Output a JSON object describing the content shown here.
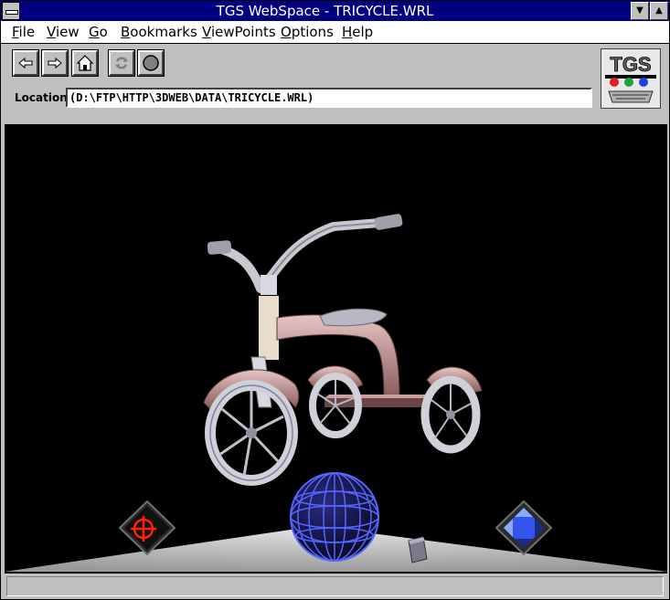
{
  "window": {
    "title": "TGS WebSpace - TRICYCLE.WRL",
    "minimize_glyph": "▼",
    "maximize_glyph": "▲"
  },
  "menubar": {
    "items": [
      {
        "label": "File"
      },
      {
        "label": "View"
      },
      {
        "label": "Go"
      },
      {
        "label": "Bookmarks"
      },
      {
        "label": "ViewPoints"
      },
      {
        "label": "Options"
      },
      {
        "label": "Help"
      }
    ]
  },
  "toolbar": {
    "buttons": [
      {
        "icon": "back-arrow-icon"
      },
      {
        "icon": "forward-arrow-icon"
      },
      {
        "icon": "home-icon"
      },
      {
        "icon": "reload-icon",
        "disabled": true
      },
      {
        "icon": "stop-icon"
      }
    ],
    "logo_text": "TGS"
  },
  "location": {
    "label": "Location:",
    "value": "(D:\\FTP\\HTTP\\3DWEB\\DATA\\TRICYCLE.WRL)"
  },
  "viewer": {
    "scene": "tricycle",
    "background_color": "#000000",
    "controls": [
      {
        "name": "seek-target",
        "icon": "crosshair-icon",
        "color": "#ff2200"
      },
      {
        "name": "examine-ball",
        "icon": "globe-icon",
        "color": "#5566ff"
      },
      {
        "name": "zoom-dolly",
        "icon": "dolly-icon"
      },
      {
        "name": "pan-control",
        "icon": "four-way-arrow-icon",
        "color": "#3355ee"
      }
    ]
  },
  "status_bar": {
    "text": ""
  }
}
